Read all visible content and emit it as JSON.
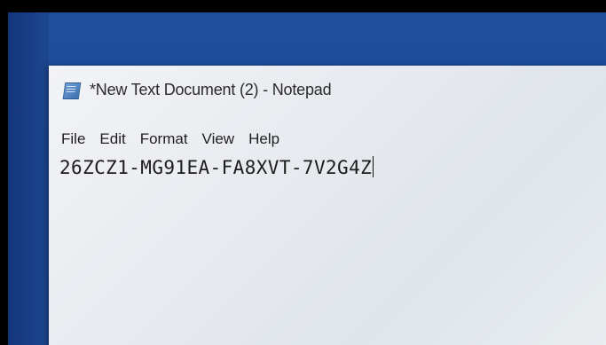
{
  "window": {
    "title": "*New Text Document (2) - Notepad",
    "icon": "notepad-icon"
  },
  "menu": {
    "items": [
      "File",
      "Edit",
      "Format",
      "View",
      "Help"
    ]
  },
  "editor": {
    "content": "26ZCZ1-MG91EA-FA8XVT-7V2G4Z"
  },
  "colors": {
    "desktop": "#1f4e9c",
    "window_bg": "#eceef2",
    "text": "#1c1c1c"
  }
}
